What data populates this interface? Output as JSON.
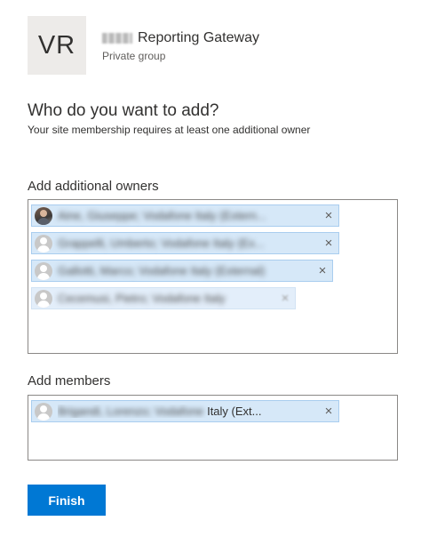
{
  "group": {
    "initials": "VR",
    "name": "Reporting Gateway",
    "type": "Private group"
  },
  "prompt": {
    "title": "Who do you want to add?",
    "subtitle": "Your site membership requires at least one additional owner"
  },
  "owners": {
    "label": "Add additional owners",
    "people": [
      {
        "name": "Aine, Giuseppe; Vodafone Italy (Extern...",
        "avatar": "photo",
        "remove_icon": "×"
      },
      {
        "name": "Grappelli, Umberto; Vodafone Italy (Ex...",
        "avatar": "placeholder",
        "remove_icon": "×"
      },
      {
        "name": "Gallotti, Marco; Vodafone Italy (External)",
        "avatar": "placeholder",
        "remove_icon": "×"
      },
      {
        "name": "Cecemusi, Pietro; Vodafone Italy",
        "avatar": "placeholder",
        "remove_icon": "×"
      }
    ]
  },
  "members": {
    "label": "Add members",
    "people": [
      {
        "name_hidden": "Brigandi, Lorenzo; Vodafone",
        "name_visible": "Italy (Ext...",
        "avatar": "placeholder",
        "remove_icon": "×"
      }
    ]
  },
  "finish_label": "Finish"
}
